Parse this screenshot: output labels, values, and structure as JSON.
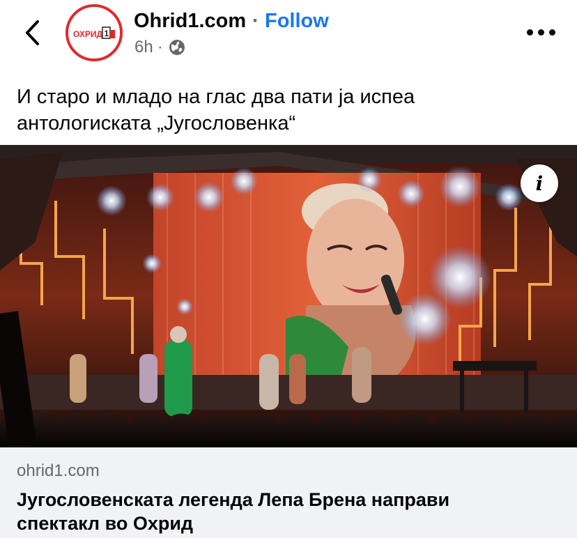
{
  "header": {
    "back_icon": "chevron-left-icon",
    "page_name": "Ohrid1.com",
    "separator": "·",
    "follow_label": "Follow",
    "time": "6h",
    "meta_separator": "·",
    "audience_icon": "globe-icon",
    "more_icon": "more-horizontal-icon",
    "avatar_logo_text": "ОХРИД 1",
    "avatar_border_color": "#e4262b"
  },
  "post": {
    "text_line1": "И старо и младо на глас два пати ја испеа",
    "text_line2": "антологиската  „Југословенка“"
  },
  "media": {
    "info_label": "i",
    "description_icon": "concert-photo"
  },
  "link_preview": {
    "domain": "ohrid1.com",
    "title_line1": "Југословенската легенда Лепа Брена направи",
    "title_line2": "спектакл во Охрид"
  },
  "colors": {
    "follow": "#1877f2",
    "secondary_text": "#65676b",
    "link_preview_bg": "#f0f2f5"
  }
}
